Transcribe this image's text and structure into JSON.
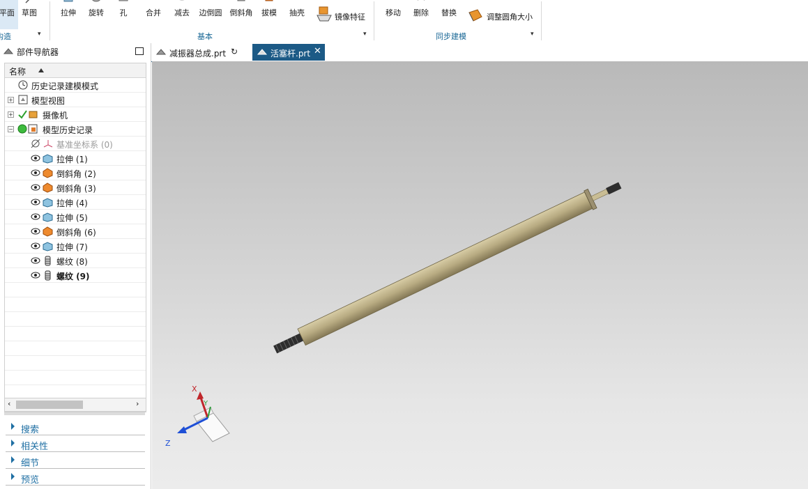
{
  "ribbon": {
    "left_partial": {
      "btn1": "平面",
      "btn2": "草图",
      "group": "构造"
    },
    "basic": {
      "buttons": [
        "拉伸",
        "旋转",
        "孔",
        "合并",
        "减去",
        "边倒圆",
        "倒斜角",
        "拔模",
        "抽壳",
        "镜像特征"
      ],
      "group": "基本"
    },
    "sync": {
      "buttons": [
        "移动",
        "删除",
        "替换",
        "调整圆角大小"
      ],
      "group": "同步建模"
    }
  },
  "navigator": {
    "title": "部件导航器",
    "column_header": "名称",
    "tree": [
      {
        "label": "历史记录建模模式",
        "icon": "clock-icon",
        "level": 0,
        "expander": ""
      },
      {
        "label": "模型视图",
        "icon": "model-view-icon",
        "level": 0,
        "expander": "+"
      },
      {
        "label": "摄像机",
        "icon": "camera-icon",
        "level": 0,
        "expander": "+"
      },
      {
        "label": "模型历史记录",
        "icon": "history-icon",
        "level": 0,
        "expander": "−"
      },
      {
        "label": "基准坐标系 (0)",
        "icon": "datum-csys-icon",
        "level": 1,
        "dim": true
      },
      {
        "label": "拉伸 (1)",
        "icon": "extrude-icon",
        "level": 1
      },
      {
        "label": "倒斜角 (2)",
        "icon": "chamfer-icon",
        "level": 1
      },
      {
        "label": "倒斜角 (3)",
        "icon": "chamfer-icon",
        "level": 1
      },
      {
        "label": "拉伸 (4)",
        "icon": "extrude-icon",
        "level": 1
      },
      {
        "label": "拉伸 (5)",
        "icon": "extrude-icon",
        "level": 1
      },
      {
        "label": "倒斜角 (6)",
        "icon": "chamfer-icon",
        "level": 1
      },
      {
        "label": "拉伸 (7)",
        "icon": "extrude-icon",
        "level": 1
      },
      {
        "label": "螺纹 (8)",
        "icon": "thread-icon",
        "level": 1
      },
      {
        "label": "螺纹 (9)",
        "icon": "thread-icon",
        "level": 1,
        "bold": true
      }
    ],
    "panels": [
      "搜索",
      "相关性",
      "细节",
      "预览"
    ]
  },
  "tabs": [
    {
      "label": "减振器总成.prt",
      "active": false
    },
    {
      "label": "活塞杆.prt",
      "active": true
    }
  ],
  "triad": {
    "x": "X",
    "y": "Y",
    "z": "Z"
  },
  "colors": {
    "accent": "#1c5a86",
    "label_blue": "#1a6896",
    "rod": "#b3a57c"
  }
}
